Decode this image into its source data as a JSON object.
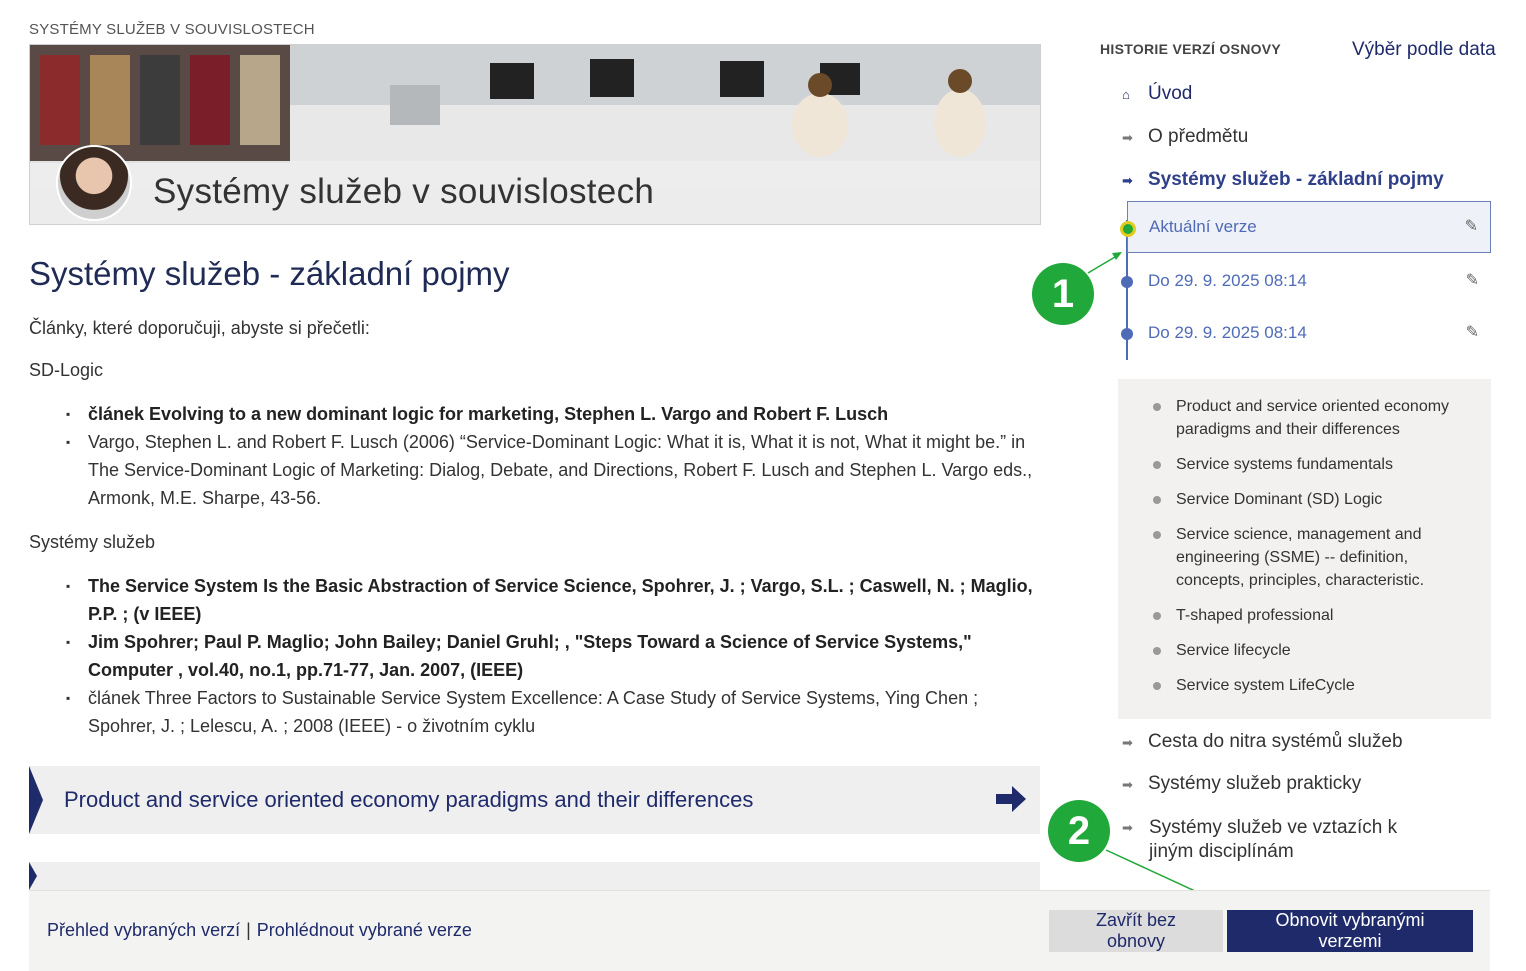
{
  "caption": "SYSTÉMY SLUŽEB V SOUVISLOSTECH",
  "banner": {
    "title": "Systémy služeb v souvislostech"
  },
  "main": {
    "heading": "Systémy služeb - základní pojmy",
    "intro": "Články, které doporučuji, abyste si přečetli:",
    "section1": "SD-Logic",
    "section1_items": [
      "článek Evolving to a new dominant logic for marketing, Stephen L. Vargo and Robert F. Lusch",
      "Vargo, Stephen L. and Robert F. Lusch (2006) “Service-Dominant Logic: What it is, What it is not, What it might be.” in The Service-Dominant Logic of Marketing: Dialog, Debate, and Directions, Robert F. Lusch and Stephen L. Vargo eds., Armonk, M.E. Sharpe, 43-56."
    ],
    "section2": "Systémy služeb",
    "section2_items": [
      "The Service System Is the Basic Abstraction of Service Science, Spohrer, J. ; Vargo, S.L. ; Caswell, N. ; Maglio, P.P. ; (v IEEE)",
      "Jim Spohrer; Paul P. Maglio; John Bailey; Daniel Gruhl; , \"Steps Toward a Science of Service Systems,\" Computer , vol.40, no.1, pp.71-77, Jan. 2007, (IEEE)",
      "článek Three Factors to Sustainable Service System Excellence: A Case Study of Service Systems, Ying Chen ; Spohrer, J. ; Lelescu, A. ; 2008 (IEEE)  - o životním cyklu"
    ],
    "accordion1": "Product and service oriented economy paradigms and their differences"
  },
  "sidebar": {
    "header": "HISTORIE VERZÍ OSNOVY",
    "date_link": "Výběr podle data",
    "nav_top": [
      "Úvod",
      "O předmětu",
      "Systémy služeb - základní pojmy"
    ],
    "versions": [
      "Aktuální verze",
      "Do 29. 9. 2025 08:14",
      "Do 29. 9. 2025 08:14"
    ],
    "subitems": [
      "Product and service oriented economy paradigms and their differences",
      "Service systems fundamentals",
      "Service Dominant (SD) Logic",
      "Service science, management and engineering (SSME) -- definition, concepts, principles, characteristic.",
      "T-shaped professional",
      "Service lifecycle",
      "Service system LifeCycle"
    ],
    "nav_bottom": [
      "Cesta do nitra systémů služeb",
      "Systémy služeb prakticky",
      "Systémy služeb ve vztazích k jiným disciplínám"
    ]
  },
  "annotations": {
    "badge1": "1",
    "badge2": "2"
  },
  "bottom_bar": {
    "link1": "Přehled vybraných verzí",
    "separator": "|",
    "link2": "Prohlédnout vybrané verze",
    "close_button": "Zavřít bez obnovy",
    "restore_button": "Obnovit vybranými verzemi"
  },
  "colors": {
    "navy": "#1f2a6b",
    "version_blue": "#4f6bb8",
    "badge_green": "#21a83a",
    "current_dot": "#d9c21a"
  }
}
